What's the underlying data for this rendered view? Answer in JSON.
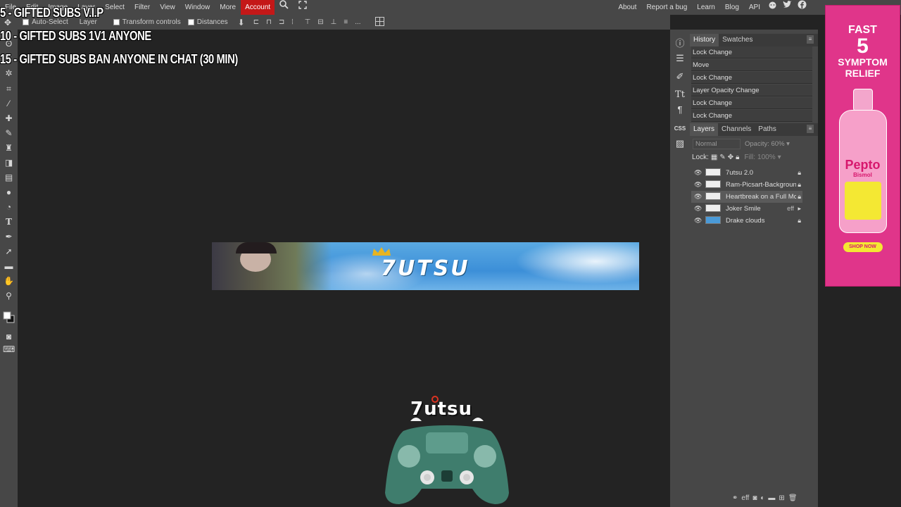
{
  "menu": {
    "items": [
      "File",
      "Edit",
      "Image",
      "Layer",
      "Select",
      "Filter",
      "View",
      "Window",
      "More"
    ],
    "account": "Account",
    "right": [
      "About",
      "Report a bug",
      "Learn",
      "Blog",
      "API"
    ]
  },
  "options": {
    "auto_select": "Auto-Select",
    "layer_select": "Layer",
    "transform": "Transform controls",
    "distances": "Distances",
    "more": "..."
  },
  "overlay": {
    "line1": "5 - GIFTED SUBS V.I.P",
    "line2": "10 - GIFTED SUBS 1V1 ANYONE",
    "line3": "15 - GIFTED SUBS BAN ANYONE IN CHAT (30 MIN)"
  },
  "banner": {
    "logo": "7UTSU"
  },
  "controller": {
    "logo": "7utsu"
  },
  "icons_right": {
    "css": "CSS"
  },
  "history": {
    "tab_history": "History",
    "tab_swatches": "Swatches",
    "items": [
      "Lock Change",
      "Move",
      "Lock Change",
      "Layer Opacity Change",
      "Lock Change",
      "Lock Change"
    ]
  },
  "layers_panel": {
    "tab_layers": "Layers",
    "tab_channels": "Channels",
    "tab_paths": "Paths",
    "blend": "Normal",
    "opacity_label": "Opacity:",
    "opacity_value": "60%",
    "lock_label": "Lock:",
    "fill_label": "Fill:",
    "fill_value": "100%",
    "layers": [
      "7utsu 2.0",
      "Ram-Picsart-Background",
      "Heartbreak on a Full Moon",
      "Joker Smile",
      "Drake clouds"
    ],
    "eff": "eff"
  },
  "ad": {
    "line1": "FAST",
    "line2": "5",
    "line3": "SYMPTOM",
    "line4": "RELIEF",
    "brand": "Pepto",
    "brand2": "Bismol",
    "cta": "SHOP NOW"
  },
  "colors": {
    "accent": "#c41818",
    "panel": "#474747",
    "canvas": "#232323",
    "ad_bg": "#e0358a"
  }
}
